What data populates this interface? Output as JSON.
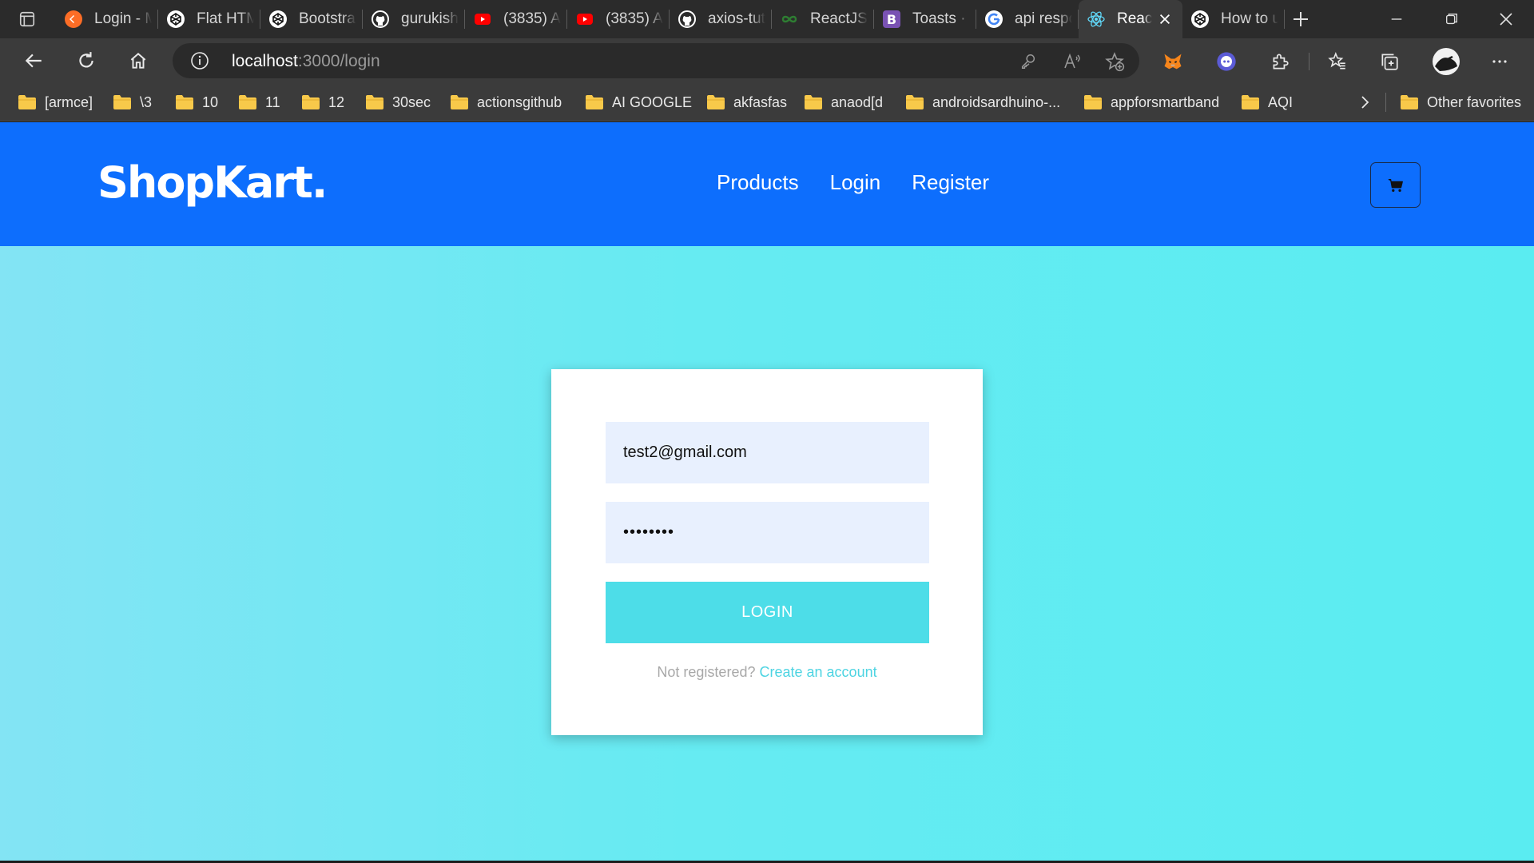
{
  "browser": {
    "tabs": [
      {
        "title": "Login - M",
        "icon": "gitlab-icon"
      },
      {
        "title": "Flat HTM",
        "icon": "codepen-icon"
      },
      {
        "title": "Bootstrap",
        "icon": "codepen-icon"
      },
      {
        "title": "gurukish",
        "icon": "github-icon"
      },
      {
        "title": "(3835) A",
        "icon": "youtube-icon"
      },
      {
        "title": "(3835) A",
        "icon": "youtube-icon"
      },
      {
        "title": "axios-tut",
        "icon": "github-icon"
      },
      {
        "title": "ReactJS T",
        "icon": "infinity-icon"
      },
      {
        "title": "Toasts · B",
        "icon": "bootstrap-icon"
      },
      {
        "title": "api respo",
        "icon": "google-icon"
      },
      {
        "title": "React",
        "icon": "react-icon",
        "active": true
      },
      {
        "title": "How to u",
        "icon": "codepen-icon"
      }
    ],
    "url_host": "localhost",
    "url_path": ":3000/login",
    "bookmarks": [
      "[armce]",
      "\\3",
      "10",
      "11",
      "12",
      "30sec",
      "actionsgithub",
      "AI GOOGLE",
      "akfasfas",
      "anaod[d",
      "androidsardhuino-...",
      "appforsmartband",
      "AQI"
    ],
    "other_favorites": "Other favorites"
  },
  "app": {
    "brand": "ShopKart.",
    "nav": {
      "products": "Products",
      "login": "Login",
      "register": "Register"
    },
    "cart_icon": "cart-icon"
  },
  "login_form": {
    "email_value": "test2@gmail.com",
    "password_value": "••••••••",
    "submit_label": "LOGIN",
    "prompt_text": "Not registered?",
    "create_link": "Create an account"
  },
  "colors": {
    "navbar": "#0d6efd",
    "button": "#4ddde8",
    "input_bg": "#e8f0fe",
    "link": "#4dd4e2"
  }
}
